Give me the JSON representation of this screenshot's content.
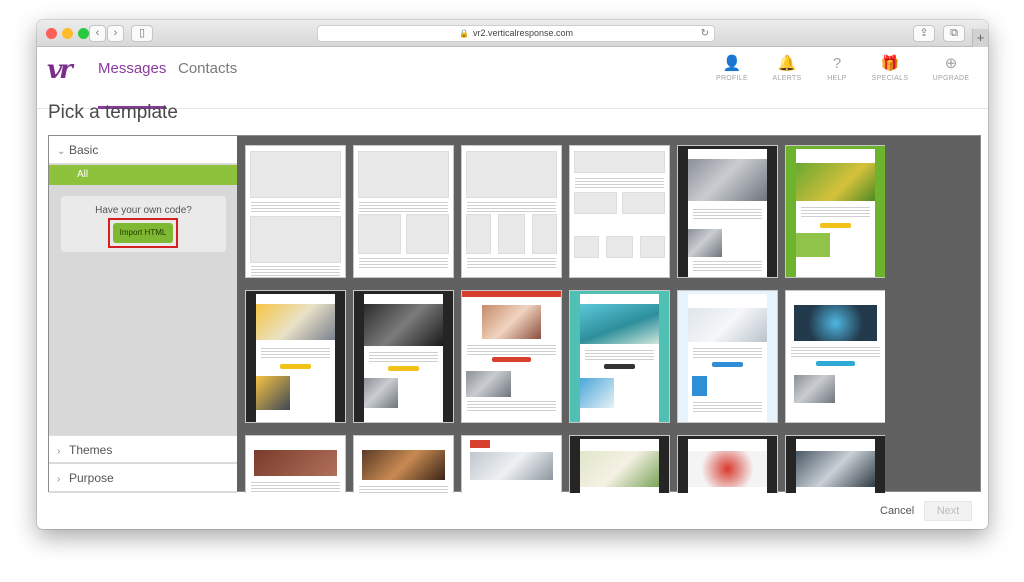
{
  "browser": {
    "url": "vr2.verticalresponse.com",
    "traffic_lights": {
      "close": "#fc5f57",
      "minimize": "#fdbc2e",
      "zoom": "#29c940"
    }
  },
  "nav": {
    "logo": "vr",
    "tabs": [
      {
        "label": "Messages",
        "active": true
      },
      {
        "label": "Contacts",
        "active": false
      }
    ],
    "icons": [
      {
        "label": "PROFILE",
        "icon": "person-icon"
      },
      {
        "label": "ALERTS",
        "icon": "bell-icon"
      },
      {
        "label": "HELP",
        "icon": "question-icon"
      },
      {
        "label": "SPECIALS",
        "icon": "gift-icon"
      },
      {
        "label": "UPGRADE",
        "icon": "upgrade-arrow-icon"
      }
    ]
  },
  "page": {
    "title": "Pick a template"
  },
  "sidebar": {
    "basic": "Basic",
    "all": "All",
    "own_code": "Have your own code?",
    "import": "Import HTML",
    "themes": "Themes",
    "purpose": "Purpose"
  },
  "footer": {
    "cancel": "Cancel",
    "next": "Next"
  },
  "colors": {
    "brand": "#8a3b9e",
    "accent_green": "#8ec13c",
    "highlight_red": "#d42020"
  }
}
